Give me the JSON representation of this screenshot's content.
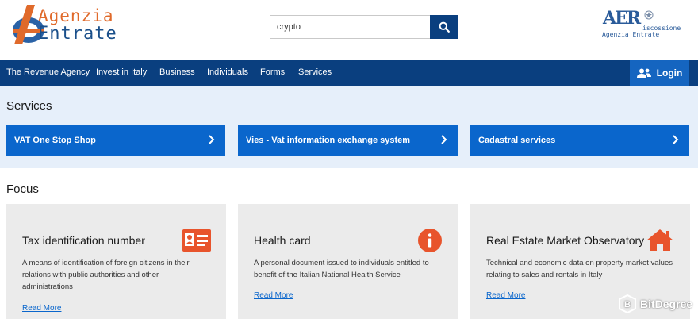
{
  "header": {
    "logo": {
      "line1": "Agenzia",
      "line2": "Entrate"
    },
    "search": {
      "value": "crypto"
    },
    "riscossione": {
      "big": "AER",
      "line1": "iscossione",
      "line2": "Agenzia Entrate"
    }
  },
  "nav": {
    "items": [
      "The Revenue Agency",
      "Invest in Italy",
      "Business",
      "Individuals",
      "Forms",
      "Services"
    ],
    "login": "Login"
  },
  "services": {
    "title": "Services",
    "buttons": [
      "VAT One Stop Shop",
      "Vies - Vat information exchange system",
      "Cadastral services"
    ]
  },
  "focus": {
    "title": "Focus",
    "cards": [
      {
        "title": "Tax identification number",
        "description": "A means of identification of foreign citizens in their relations with public authorities and other administrations",
        "link": "Read More",
        "icon": "id-card-icon"
      },
      {
        "title": "Health card",
        "description": "A personal document issued to individuals entitled to benefit of the Italian National Health Service",
        "link": "Read More",
        "icon": "info-icon"
      },
      {
        "title": "Real Estate Market Observatory",
        "description": "Technical and economic data on property market values relating to sales and rentals in Italy",
        "link": "Read More",
        "icon": "home-icon"
      }
    ]
  },
  "watermark": {
    "text": "BitDegree"
  },
  "colors": {
    "navy": "#0a3f7f",
    "blue": "#0a66cc",
    "orange": "#e8542c",
    "band": "#e6effa",
    "card": "#ebebeb"
  }
}
